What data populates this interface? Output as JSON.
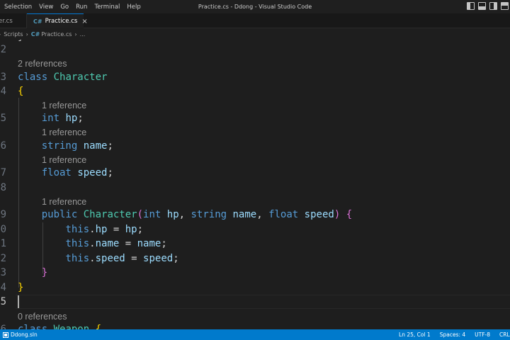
{
  "menu": [
    "Selection",
    "View",
    "Go",
    "Run",
    "Terminal",
    "Help"
  ],
  "window_title": "Practice.cs - Ddong - Visual Studio Code",
  "tabs": {
    "inactive_label": "er.cs",
    "active_label": "Practice.cs",
    "active_icon": "C#",
    "close_icon": "×"
  },
  "breadcrumb": {
    "folder": "Scripts",
    "sep": "›",
    "file": "Practice.cs",
    "tail": "..."
  },
  "editor": {
    "line_numbers": [
      "2",
      "3",
      "4",
      "5",
      "6",
      "7",
      "8",
      "9",
      "0",
      "1",
      "2",
      "3",
      "4",
      "5",
      "6"
    ],
    "lens": {
      "class_refs": "2 references",
      "hp_refs": "1 reference",
      "name_refs": "1 reference",
      "speed_refs": "1 reference",
      "ctor_refs": "1 reference",
      "weapon_refs": "0 references"
    },
    "code": {
      "kw_class": "class",
      "t_character": "Character",
      "open_brace": "{",
      "close_brace": "}",
      "kw_int": "int",
      "kw_string": "string",
      "kw_float": "float",
      "kw_public": "public",
      "kw_this": "this",
      "f_hp": "hp",
      "f_name": "name",
      "f_speed": "speed",
      "semi": ";",
      "dot": ".",
      "assign": " = ",
      "comma": ", ",
      "lparen": "(",
      "rparen": ")",
      "t_weapon": "Weapon"
    },
    "top_partial": "}"
  },
  "statusbar": {
    "solution": "Ddong.sln",
    "position": "Ln 25, Col 1",
    "spaces": "Spaces: 4",
    "encoding": "UTF-8",
    "eol": "CRLF"
  }
}
